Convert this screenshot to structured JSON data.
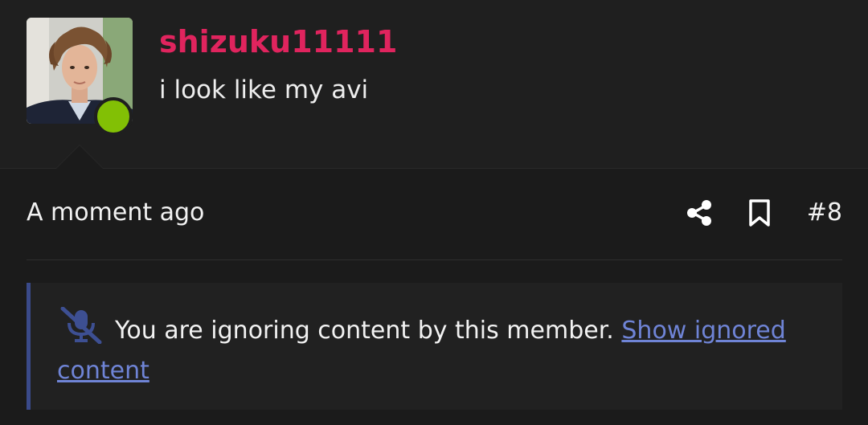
{
  "user": {
    "username": "shizuku11111",
    "title": "i look like my avi",
    "username_color": "#e0245e",
    "online": true,
    "online_color": "#82c005"
  },
  "post": {
    "timestamp": "A moment ago",
    "number": "#8",
    "actions": {
      "share_icon": "share-icon",
      "bookmark_icon": "bookmark-icon"
    }
  },
  "ignored_notice": {
    "icon": "microphone-slash-icon",
    "message": "You are ignoring content by this member.",
    "link_text": "Show ignored content",
    "link_color": "#6f84d6"
  },
  "colors": {
    "background": "#1b1b1b",
    "text": "#f2f2f2",
    "notice_border": "#3a4a8a"
  }
}
